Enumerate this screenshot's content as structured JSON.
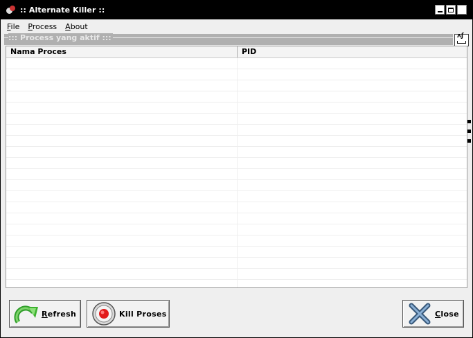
{
  "window": {
    "title": ":: Alternate Killer ::"
  },
  "menu": [
    {
      "label": "File",
      "accel": "F",
      "rest": "ile"
    },
    {
      "label": "Process",
      "accel": "P",
      "rest": "rocess"
    },
    {
      "label": "About",
      "accel": "A",
      "rest": "bout"
    }
  ],
  "group": {
    "title": "::: Process yang aktif :::"
  },
  "table": {
    "columns": [
      "Nama Proces",
      "PID"
    ],
    "rows": []
  },
  "buttons": {
    "refresh": {
      "accel": "R",
      "rest": "efresh",
      "icon": "refresh-arrow-icon"
    },
    "kill": {
      "label": "Kill Proses",
      "icon": "record-stop-icon"
    },
    "close": {
      "accel": "C",
      "rest": "lose",
      "icon": "close-x-icon"
    }
  },
  "colors": {
    "titlebar": "#000000",
    "group_bar": "#b0b0b0",
    "kill_red": "#e21a1a",
    "refresh_green": "#3cb22e",
    "close_blue": "#4a6f97"
  }
}
